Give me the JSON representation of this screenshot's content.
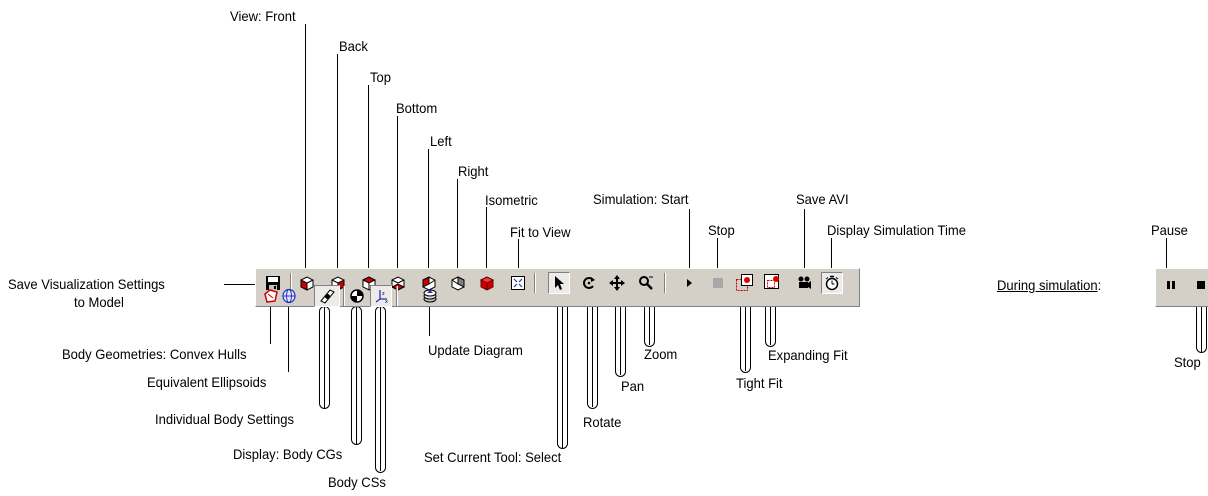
{
  "labels": {
    "view_front": "View: Front",
    "back": "Back",
    "top": "Top",
    "bottom": "Bottom",
    "left": "Left",
    "right": "Right",
    "isometric": "Isometric",
    "fit_to_view": "Fit to View",
    "sim_start": "Simulation: Start",
    "stop": "Stop",
    "save_avi": "Save AVI",
    "display_sim_time": "Display Simulation Time",
    "pause": "Pause",
    "during_simulation": "During simulation",
    "during_colon": ":",
    "stop_during": "Stop",
    "save_vis_line1": "Save Visualization Settings",
    "save_vis_line2": "to Model",
    "convex_hulls": "Body Geometries: Convex Hulls",
    "ellipsoids": "Equivalent Ellipsoids",
    "individual_body": "Individual Body Settings",
    "body_cgs": "Display: Body CGs",
    "body_css": "Body CSs",
    "update_diagram": "Update Diagram",
    "set_tool_select": "Set Current Tool: Select",
    "rotate": "Rotate",
    "pan": "Pan",
    "zoom": "Zoom",
    "tight_fit": "Tight Fit",
    "expanding_fit": "Expanding Fit"
  },
  "toolbar": {
    "row1_icons": [
      "save-icon",
      "view-front-icon",
      "view-back-icon",
      "view-top-icon",
      "view-bottom-icon",
      "view-left-icon",
      "view-right-icon",
      "view-isometric-icon",
      "fit-to-view-icon",
      "select-tool-icon",
      "rotate-tool-icon",
      "pan-tool-icon",
      "zoom-tool-icon",
      "simulation-start-icon",
      "simulation-stop-icon",
      "tight-fit-icon",
      "expanding-fit-icon",
      "save-avi-icon",
      "simulation-time-icon"
    ],
    "row2_icons": [
      "convex-hulls-icon",
      "ellipsoids-icon",
      "individual-body-icon",
      "body-cgs-icon",
      "body-css-icon",
      "update-diagram-icon"
    ],
    "pressed": [
      "select-tool-icon",
      "body-css-icon"
    ]
  },
  "simulation_toolbar": {
    "icons": [
      "pause-icon",
      "stop-icon"
    ]
  },
  "colors": {
    "toolbar_bg": "#d4d0c8",
    "cube_red": "#cc0000",
    "leader_line": "#000000"
  }
}
